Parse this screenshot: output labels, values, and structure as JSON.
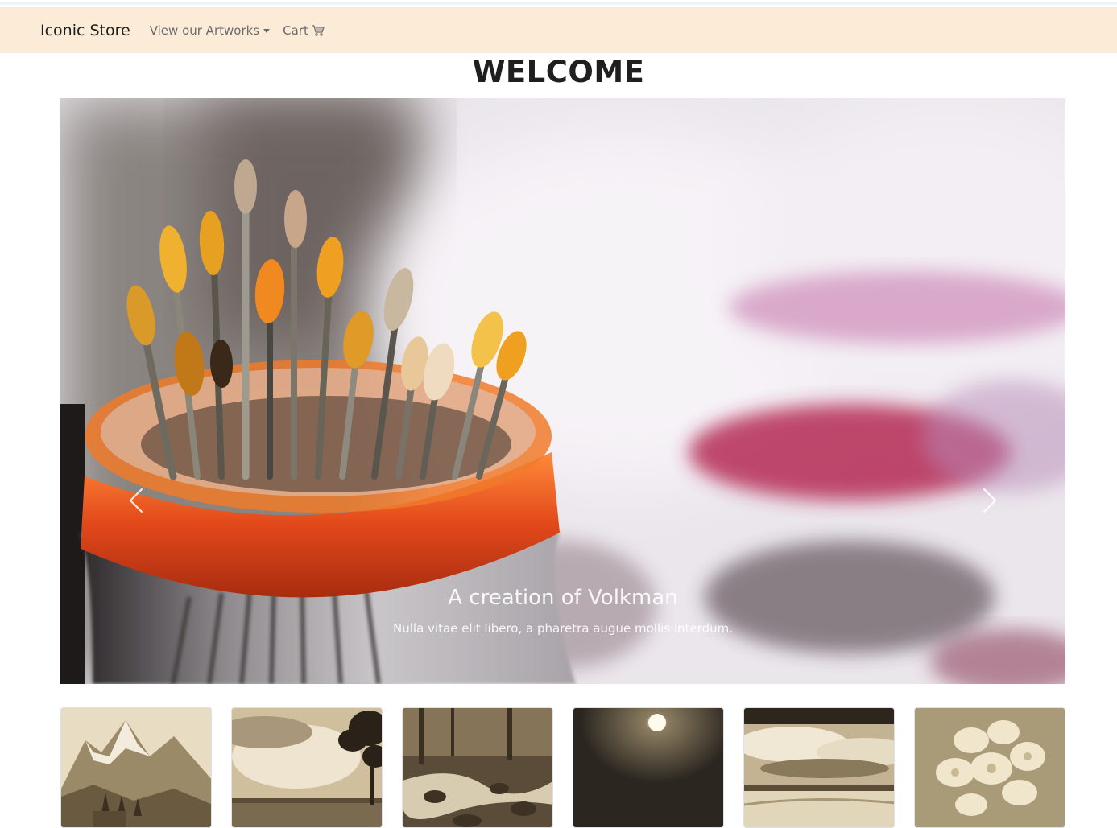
{
  "nav": {
    "brand": "Iconic Store",
    "artworks_label": "View our Artworks",
    "cart_label": "Cart",
    "background": "#fbebd7"
  },
  "page": {
    "heading": "WELCOME"
  },
  "carousel": {
    "caption_title": "A creation of Volkman",
    "caption_text": "Nulla vitae elit libero, a pharetra augue mollis interdum.",
    "prev_icon": "chevron-left-icon",
    "next_icon": "chevron-right-icon"
  },
  "thumbnails": [
    {
      "subject": "mountains"
    },
    {
      "subject": "sky-with-tree"
    },
    {
      "subject": "forest-stream"
    },
    {
      "subject": "moon"
    },
    {
      "subject": "beach-clouds"
    },
    {
      "subject": "flowers"
    }
  ]
}
